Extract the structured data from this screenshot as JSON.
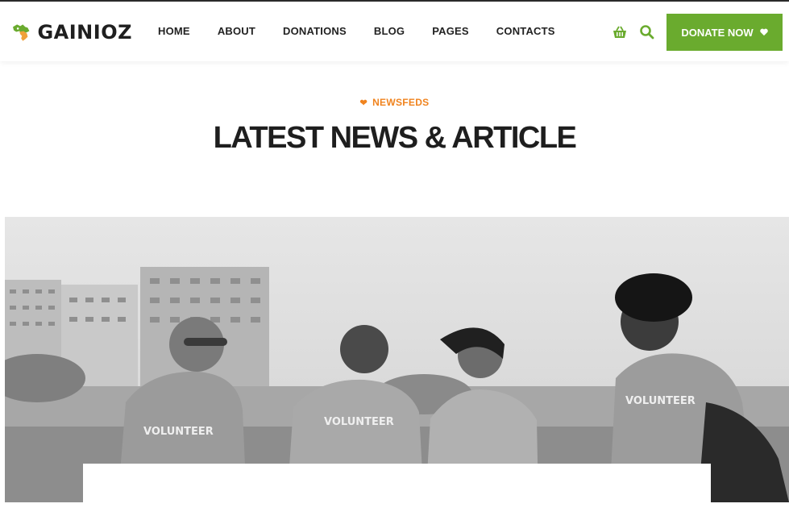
{
  "brand": {
    "name": "GAINIOZ"
  },
  "nav": {
    "items": [
      "HOME",
      "ABOUT",
      "DONATIONS",
      "BLOG",
      "PAGES",
      "CONTACTS"
    ]
  },
  "header": {
    "donate_label": "DONATE NOW"
  },
  "icons": {
    "cart": "basket-icon",
    "search": "search-icon",
    "heart": "heart-icon"
  },
  "section": {
    "tag": "NEWSFEDS",
    "title": "LATEST NEWS & ARTICLE"
  },
  "photo": {
    "shirt_text": [
      "VOLUNTEER",
      "VOLUNTEER",
      "VOLUNTEER"
    ]
  },
  "colors": {
    "accent_green": "#6aab2e",
    "accent_orange": "#f0831e",
    "text_dark": "#1e1e1e"
  }
}
